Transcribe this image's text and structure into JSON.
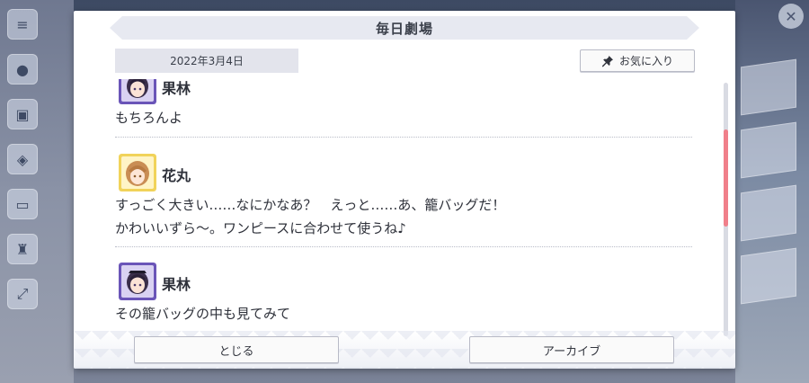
{
  "modal": {
    "title": "毎日劇場",
    "date": "2022年3月4日",
    "favorite_label": "お気に入り",
    "close_label": "とじる",
    "archive_label": "アーカイブ"
  },
  "messages": [
    {
      "speaker": "果林",
      "avatar": "karin-avatar",
      "lines": [
        "もちろんよ"
      ]
    },
    {
      "speaker": "花丸",
      "avatar": "hanamaru-avatar",
      "lines": [
        "すっごく大きい……なにかなあ？　えっと……あ、籠バッグだ！",
        "かわいいずら〜。ワンピースに合わせて使うね♪"
      ]
    },
    {
      "speaker": "果林",
      "avatar": "karin-avatar",
      "lines": [
        "その籠バッグの中も見てみて"
      ]
    }
  ],
  "colors": {
    "accent": "#f07f8a",
    "karin_frame": "#6a55b8",
    "hanamaru_frame": "#f1d35a"
  },
  "scroll": {
    "position_fraction": 0.27
  }
}
